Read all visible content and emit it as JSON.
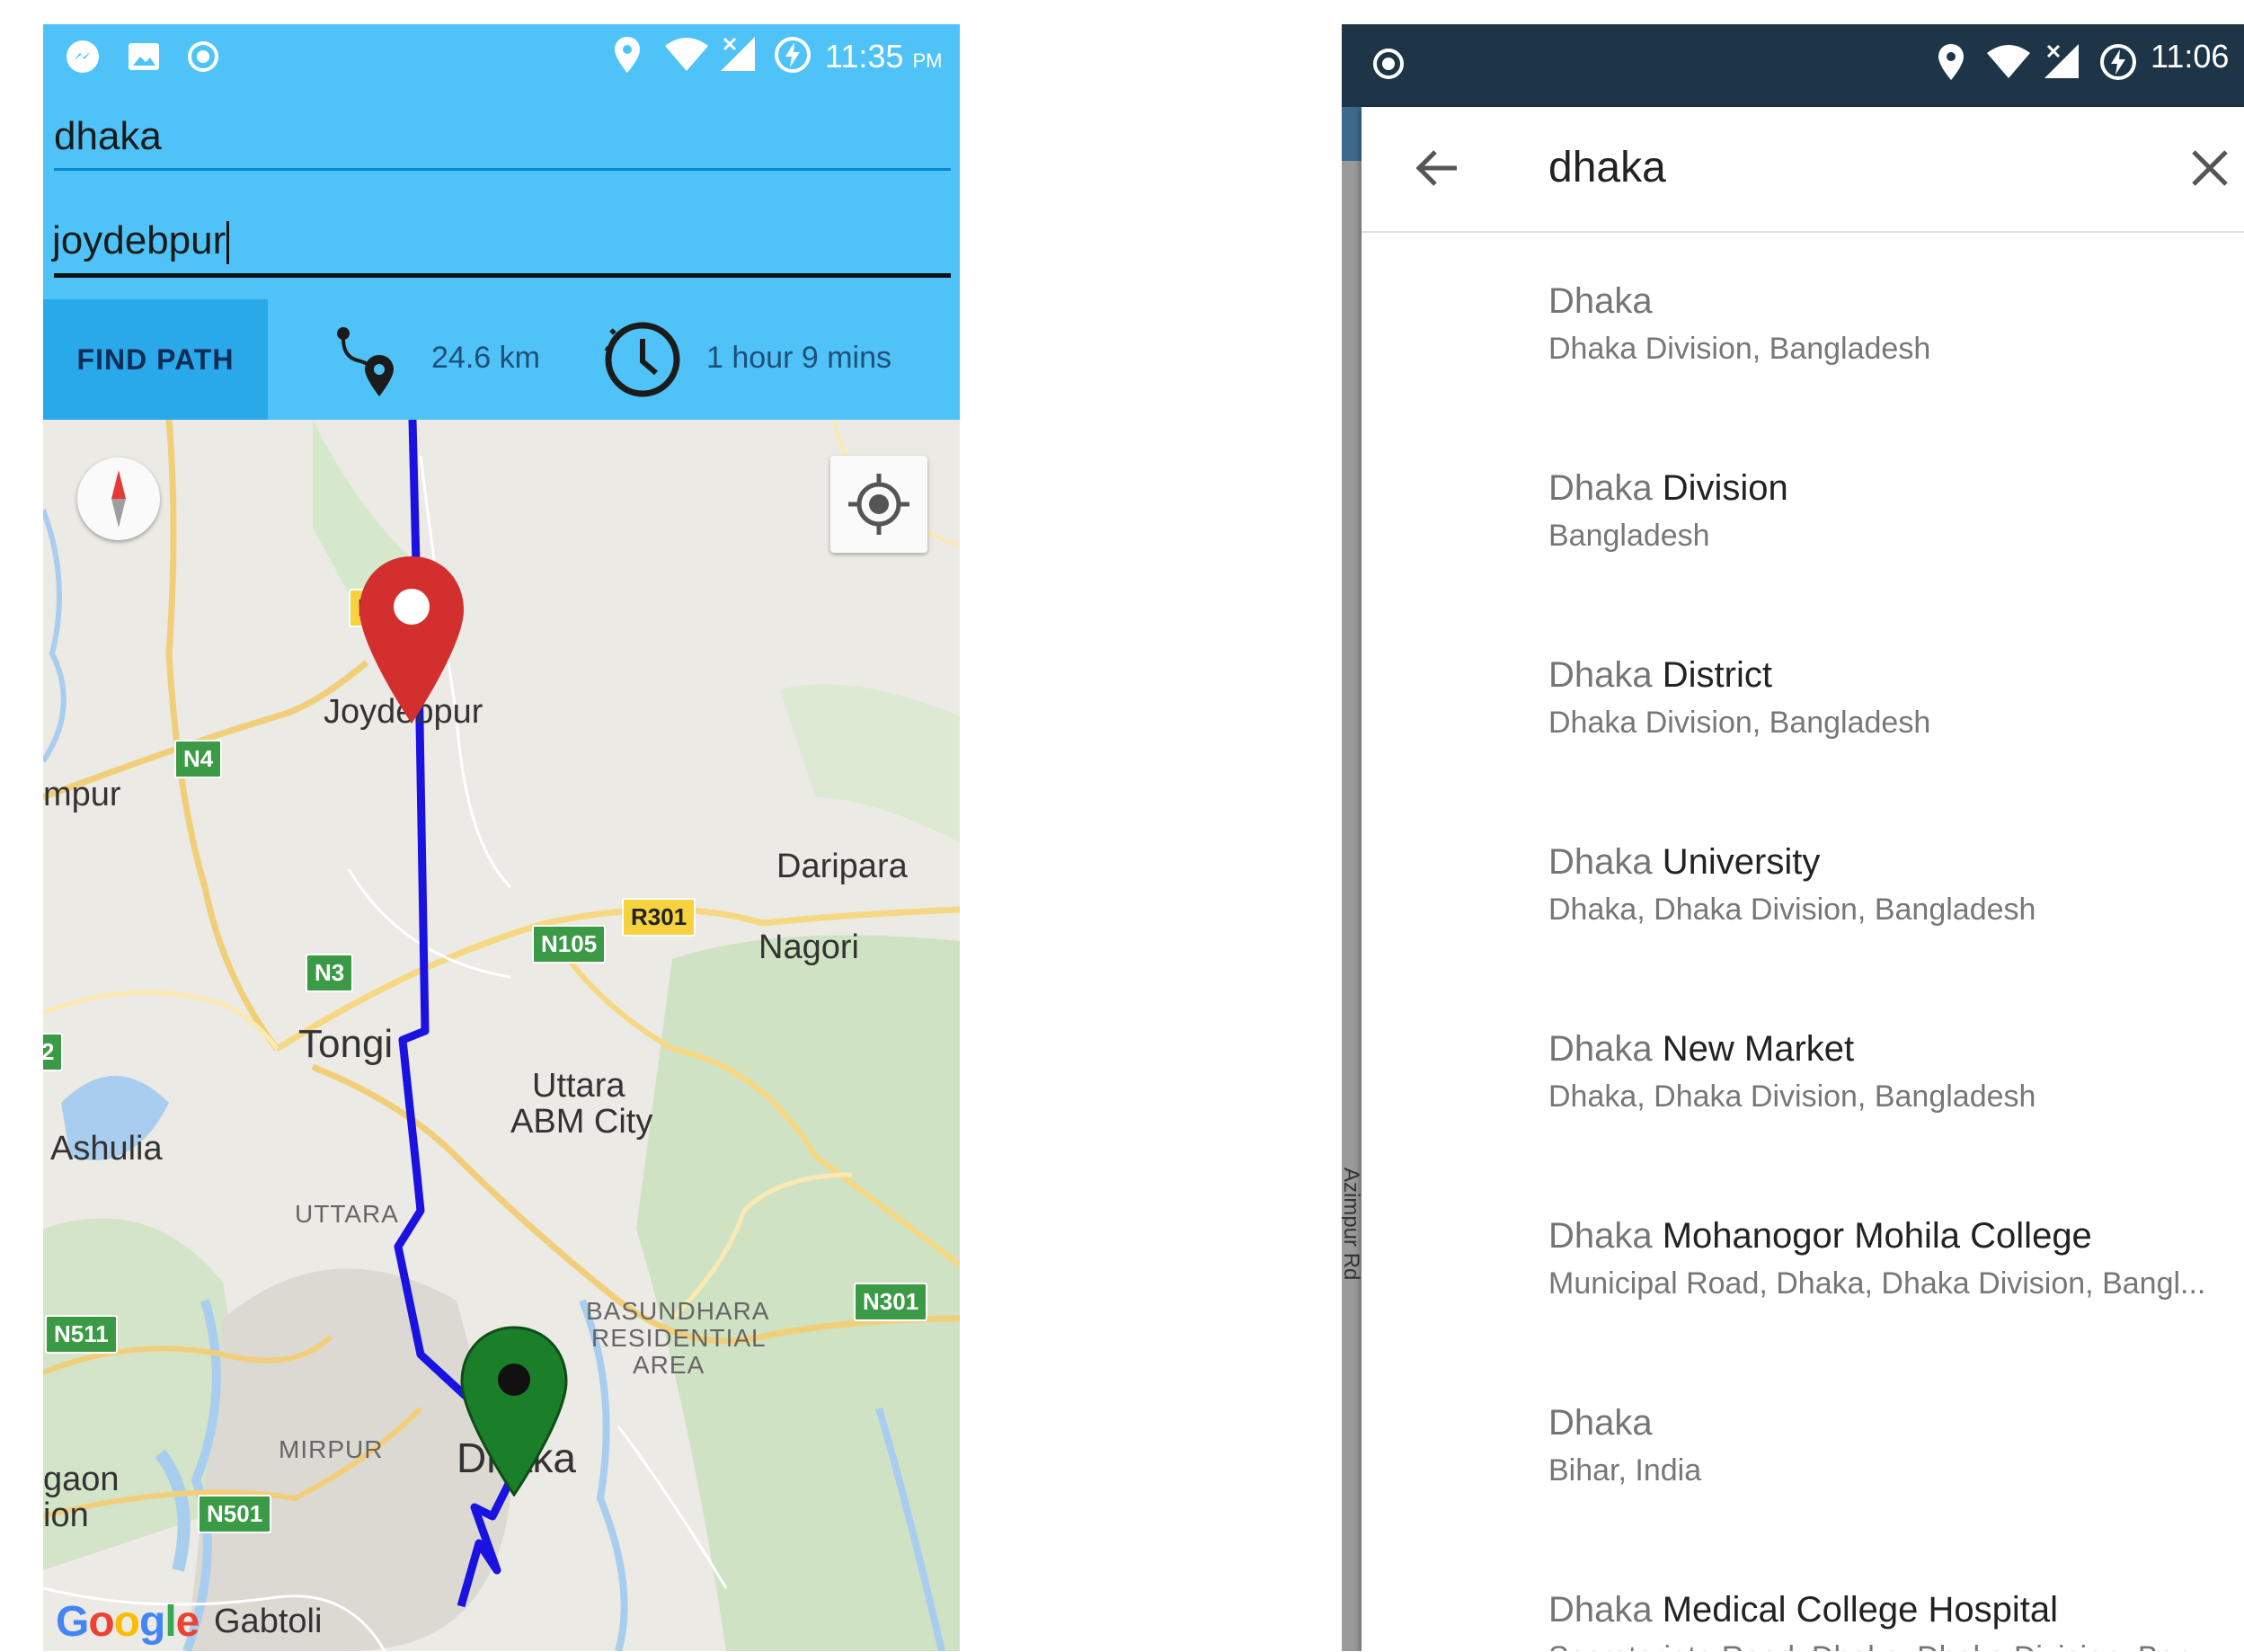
{
  "left_screen": {
    "status_bar": {
      "time": "11:35",
      "ampm": "PM"
    },
    "source_field": {
      "value": "dhaka"
    },
    "destination_field": {
      "value": "joydebpur"
    },
    "find_path_label": "FIND PATH",
    "distance": "24.6 km",
    "duration": "1 hour 9 mins",
    "route_color": "#1a12e0",
    "origin_marker_color": "#d32f2f",
    "destination_marker_color": "#1b7f2a",
    "map": {
      "places": {
        "joydebpur": "Joydebpur",
        "tongi": "Tongi",
        "daripara": "Daripara",
        "nagori": "Nagori",
        "uttara1": "Uttara",
        "uttara2": "ABM City",
        "ashulia": "Ashulia",
        "dhaka": "Dhaka",
        "gabtoli": "Gabtoli",
        "mpur": "mpur",
        "gaon1": "gaon",
        "gaon2": "ion",
        "uttara_area": "UTTARA",
        "mirpur": "MIRPUR",
        "basundhara1": "BASUNDHARA",
        "basundhara2": "RESIDENTIAL",
        "basundhara3": "AREA"
      },
      "shields": {
        "n4": "N4",
        "n3": "N3",
        "n105": "N105",
        "r301": "R301",
        "n301": "N301",
        "n511": "N511",
        "n501": "N501",
        "two": "2",
        "r": "R"
      },
      "google_logo": "Google"
    }
  },
  "right_screen": {
    "status_bar": {
      "time": "11:06"
    },
    "search_query": "dhaka",
    "side_road_label": "Azimpur Rd",
    "suggestions": [
      {
        "prefix": "Dhaka",
        "rest": "",
        "sub": "Dhaka Division, Bangladesh"
      },
      {
        "prefix": "Dhaka",
        "rest": " Division",
        "sub": "Bangladesh"
      },
      {
        "prefix": "Dhaka",
        "rest": " District",
        "sub": "Dhaka Division, Bangladesh"
      },
      {
        "prefix": "Dhaka",
        "rest": " University",
        "sub": "Dhaka, Dhaka Division, Bangladesh"
      },
      {
        "prefix": "Dhaka",
        "rest": " New Market",
        "sub": "Dhaka, Dhaka Division, Bangladesh"
      },
      {
        "prefix": "Dhaka",
        "rest": " Mohanogor Mohila College",
        "sub": "Municipal Road, Dhaka, Dhaka Division, Bangl..."
      },
      {
        "prefix": "Dhaka",
        "rest": "",
        "sub": "Bihar, India"
      },
      {
        "prefix": "Dhaka",
        "rest": " Medical College Hospital",
        "sub": "Secretariate Road, Dhaka, Dhaka Division, Ban..."
      }
    ]
  }
}
